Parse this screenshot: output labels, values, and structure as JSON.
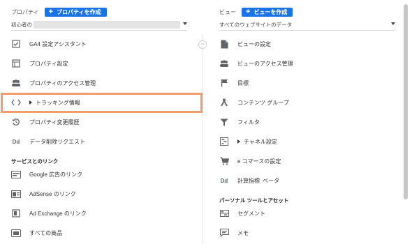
{
  "property": {
    "header_label": "プロパティ",
    "create_button": "プロパティを作成",
    "selected": "初心者の",
    "items": [
      {
        "label": "GA4 設定アシスタント",
        "icon": "checklist-icon"
      },
      {
        "label": "プロパティ設定",
        "icon": "property-settings-icon"
      },
      {
        "label": "プロパティのアクセス管理",
        "icon": "people-icon"
      },
      {
        "label": "トラッキング情報",
        "icon": "code-icon",
        "expandable": true
      },
      {
        "label": "プロパティ変更履歴",
        "icon": "history-icon"
      },
      {
        "label": "データ削除リクエスト",
        "icon": "dd-icon",
        "icon_text": "Dd"
      }
    ],
    "section_services": "サービスとのリンク",
    "service_items": [
      {
        "label": "Google 広告のリンク",
        "icon": "ads-icon"
      },
      {
        "label": "AdSense のリンク",
        "icon": "adsense-icon"
      },
      {
        "label": "Ad Exchange のリンク",
        "icon": "adexchange-icon"
      },
      {
        "label": "すべての商品",
        "icon": "all-products-icon"
      }
    ]
  },
  "view": {
    "header_label": "ビュー",
    "create_button": "ビューを作成",
    "selected": "すべてのウェブサイトのデータ",
    "items": [
      {
        "label": "ビューの設定",
        "icon": "document-icon"
      },
      {
        "label": "ビューのアクセス管理",
        "icon": "people-icon"
      },
      {
        "label": "目標",
        "icon": "flag-icon"
      },
      {
        "label": "コンテンツ グループ",
        "icon": "content-group-icon"
      },
      {
        "label": "フィルタ",
        "icon": "filter-icon"
      },
      {
        "label": "チャネル設定",
        "icon": "channel-icon",
        "expandable": true
      },
      {
        "label": "e コマースの設定",
        "icon": "cart-icon"
      },
      {
        "label": "計算指標",
        "icon": "dd-icon",
        "icon_text": "Dd",
        "badge": "ベータ"
      }
    ],
    "section_personal": "パーソナル ツールとアセット",
    "personal_items": [
      {
        "label": "セグメント",
        "icon": "segment-icon"
      },
      {
        "label": "メモ",
        "icon": "memo-icon"
      }
    ]
  },
  "colors": {
    "accent": "#1a73e8",
    "highlight": "#ef9c6e",
    "beta": "#e8710a"
  }
}
